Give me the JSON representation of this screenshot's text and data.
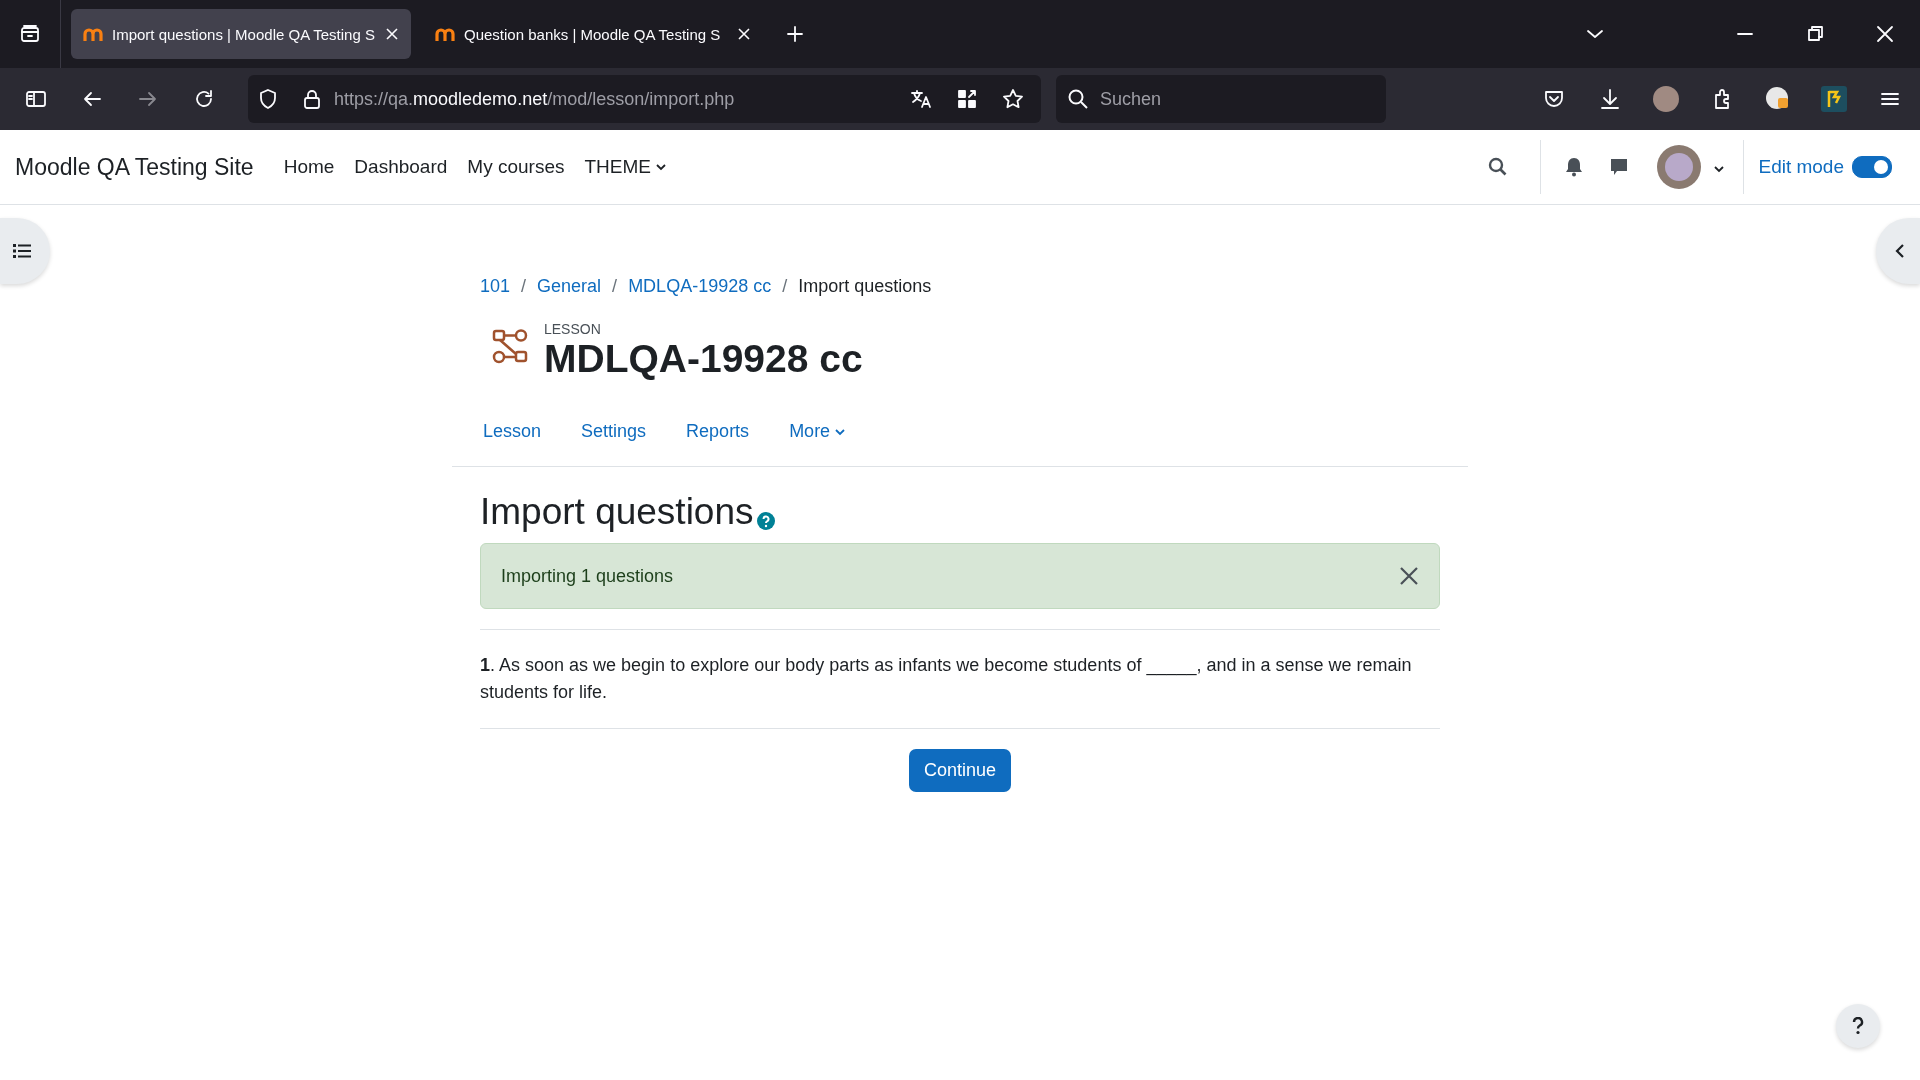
{
  "browser": {
    "tabs": [
      {
        "title": "Import questions | Moodle QA Testing S",
        "selected": true
      },
      {
        "title": "Question banks | Moodle QA Testing S",
        "selected": false
      }
    ],
    "url": {
      "scheme": "https://qa.",
      "domain": "moodledemo.net",
      "path": "/mod/lesson/import.php"
    },
    "search": {
      "placeholder": "Suchen"
    }
  },
  "site": {
    "name": "Moodle QA Testing Site",
    "nav": [
      {
        "label": "Home",
        "dropdown": false
      },
      {
        "label": "Dashboard",
        "dropdown": false
      },
      {
        "label": "My courses",
        "dropdown": false
      },
      {
        "label": "THEME",
        "dropdown": true
      }
    ],
    "edit_mode": {
      "label": "Edit mode",
      "on": true
    }
  },
  "breadcrumb": [
    {
      "kind": "link",
      "label": "101"
    },
    {
      "kind": "separator",
      "label": "/"
    },
    {
      "kind": "link",
      "label": "General"
    },
    {
      "kind": "separator",
      "label": "/"
    },
    {
      "kind": "link",
      "label": "MDLQA-19928 cc"
    },
    {
      "kind": "separator",
      "label": "/"
    },
    {
      "kind": "current",
      "label": "Import questions"
    }
  ],
  "activity": {
    "type": "LESSON",
    "title": "MDLQA-19928 cc"
  },
  "secondary_nav": [
    {
      "label": "Lesson",
      "dropdown": false
    },
    {
      "label": "Settings",
      "dropdown": false
    },
    {
      "label": "Reports",
      "dropdown": false
    },
    {
      "label": "More",
      "dropdown": true
    }
  ],
  "heading": "Import questions",
  "alert": {
    "text": "Importing 1 questions"
  },
  "questions": [
    {
      "text": "**1**. As soon as we begin to explore our body parts as infants we become students of _____, and in a sense we remain students for life."
    }
  ],
  "continue_button": "Continue"
}
